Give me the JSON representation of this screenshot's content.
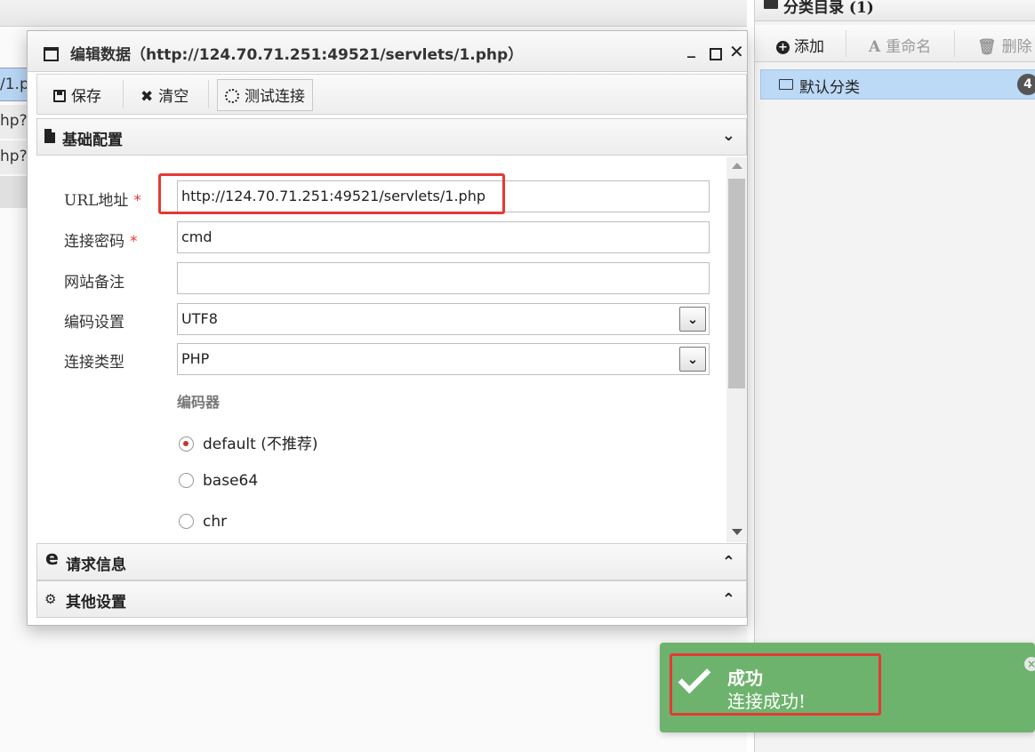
{
  "background_rows": [
    "/1.p",
    "hp?",
    "hp?",
    ""
  ],
  "right_panel": {
    "title": "分类目录 (1)",
    "toolbar": {
      "add_label": "添加",
      "rename_label": "重命名",
      "delete_label": "删除",
      "rename_glyph": "A"
    },
    "items": [
      {
        "label": "默认分类",
        "count": "4",
        "selected": true
      }
    ]
  },
  "dialog": {
    "title": "编辑数据（http://124.70.71.251:49521/servlets/1.php）",
    "controls": {
      "minimize": "_",
      "close": "✕"
    },
    "toolbar": {
      "save_label": "保存",
      "clear_label": "清空",
      "test_label": "测试连接"
    },
    "sections": {
      "basic": "基础配置",
      "request": "请求信息",
      "other": "其他设置"
    },
    "form": {
      "url_label": "URL地址",
      "url_value": "http://124.70.71.251:49521/servlets/1.php",
      "password_label": "连接密码",
      "password_value": "cmd",
      "note_label": "网站备注",
      "note_value": "",
      "encoding_label": "编码设置",
      "encoding_value": "UTF8",
      "type_label": "连接类型",
      "type_value": "PHP",
      "required_mark": "*",
      "encoder_heading": "编码器",
      "encoders": [
        {
          "label": "default (不推荐)",
          "checked": true
        },
        {
          "label": "base64",
          "checked": false
        },
        {
          "label": "chr",
          "checked": false
        }
      ]
    }
  },
  "toast": {
    "title": "成功",
    "message": "连接成功!",
    "color": "#6db36d"
  },
  "colors": {
    "highlight_red": "#e53935",
    "selection_blue": "#bcd9f6"
  }
}
